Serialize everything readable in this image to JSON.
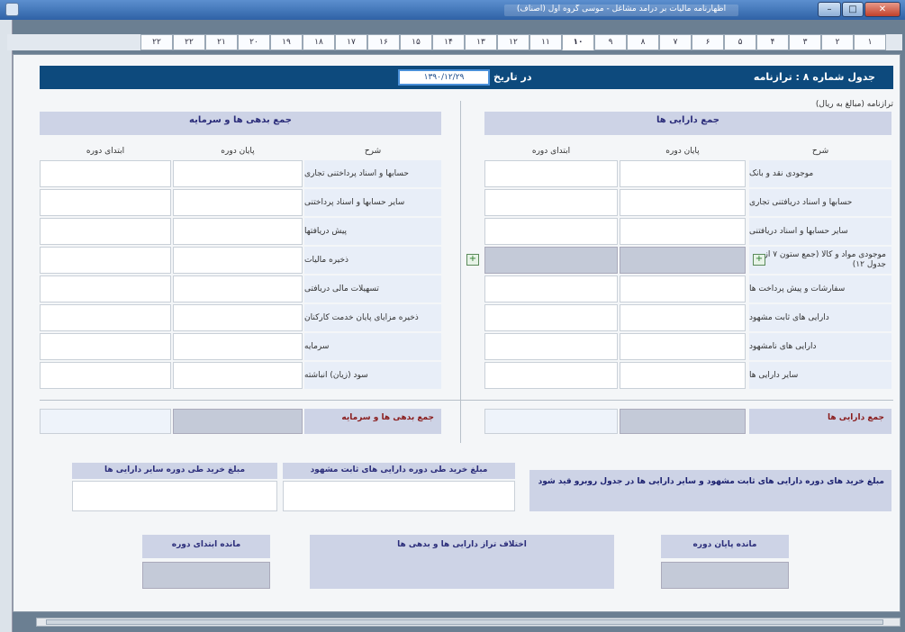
{
  "window": {
    "title": "اظهارنامه مالیات بر درآمد مشاغل - موسی گروه اول (اصناف)",
    "min": "–",
    "max": "□",
    "close": "✕"
  },
  "tabs": [
    "۲۲",
    "۲۲",
    "۲۱",
    "۲۰",
    "۱۹",
    "۱۸",
    "۱۷",
    "۱۶",
    "۱۵",
    "۱۴",
    "۱۳",
    "۱۲",
    "۱۱",
    "۱۰",
    "۹",
    "۸",
    "۷",
    "۶",
    "۵",
    "۴",
    "۳",
    "۲",
    "۱"
  ],
  "active_tab": "۱۰",
  "header": {
    "title": "جدول شماره ۸ : ترازنامه",
    "date_label": "در تاریخ",
    "date_value": "۱۳۹۰/۱۲/۲۹"
  },
  "subtitle": "ترازنامه (مبالغ به ریال)",
  "assets": {
    "banner": "جمع دارایی ها",
    "columns": {
      "desc": "شرح",
      "end": "پایان دوره",
      "start": "ابتدای دوره"
    },
    "rows": [
      "موجودی نقد و بانک",
      "حسابها و اسناد دریافتنی تجاری",
      "سایر حسابها و اسناد دریافتنی",
      "موجودی مواد و کالا (جمع ستون ۷ از جدول ۱۲)",
      "سفارشات و پیش پرداخت ها",
      "دارایی های ثابت مشهود",
      "دارایی های نامشهود",
      "سایر دارایی ها"
    ],
    "total_label": "جمع دارایی ها"
  },
  "liabilities": {
    "banner": "جمع بدهی ها و سرمایه",
    "columns": {
      "desc": "شرح",
      "end": "پایان دوره",
      "start": "ابتدای دوره"
    },
    "rows": [
      "حسابها و اسناد پرداختنی تجاری",
      "سایر حسابها و اسناد پرداختنی",
      "پیش دریافتها",
      "ذخیره مالیات",
      "تسهیلات مالی دریافتی",
      "ذخیره مزایای پایان خدمت کارکنان",
      "سرمایه",
      "سود (زیان) انباشته"
    ],
    "total_label": "جمع بدهی ها و سرمایه"
  },
  "purchases": {
    "note": "مبلغ خرید های دوره دارایی های ثابت مشهود و سایر دارایی ها در جدول روبرو قید شود",
    "fixed_label": "مبلغ خرید طی دوره دارایی های ثابت مشهود",
    "other_label": "مبلغ خرید طی دوره سایر دارایی ها"
  },
  "balances": {
    "end_label": "مانده پایان دوره",
    "diff_label": "اختلاف تراز دارایی ها و بدهی ها",
    "start_label": "مانده ابتدای دوره"
  },
  "icons": {
    "add": "plus-icon"
  }
}
